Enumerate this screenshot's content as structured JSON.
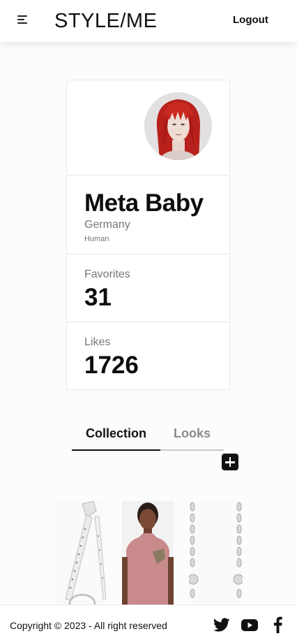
{
  "header": {
    "brand": "STYLE/ME",
    "logout_label": "Logout",
    "menu_icon": "hamburger-menu-icon"
  },
  "profile": {
    "name": "Meta Baby",
    "country": "Germany",
    "type": "Human",
    "favorites_label": "Favorites",
    "favorites_value": "31",
    "likes_label": "Likes",
    "likes_value": "1726"
  },
  "tabs": [
    {
      "label": "Collection",
      "active": true
    },
    {
      "label": "Looks",
      "active": false
    }
  ],
  "add_icon": "plus-square-icon",
  "collection": {
    "items": [
      "studded-belt-item",
      "pink-top-model-item",
      "chain-necklace-item"
    ]
  },
  "footer": {
    "copyright": "Copyright © 2023 - All right reserved",
    "social": [
      "twitter-icon",
      "youtube-icon",
      "facebook-icon"
    ]
  },
  "colors": {
    "text": "#111111",
    "muted": "#777777",
    "tab_inactive": "#8a8a8a",
    "avatar_hair": "#c8201a",
    "top_pink": "#c98a8c"
  }
}
